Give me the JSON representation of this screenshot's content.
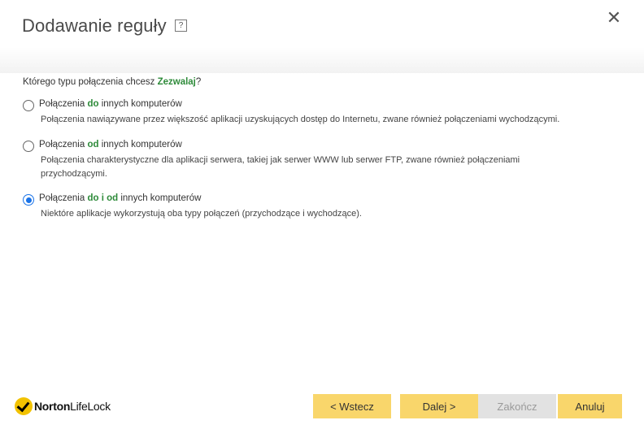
{
  "dialog": {
    "title": "Dodawanie reguły",
    "help_icon": "?",
    "close_icon": "✕"
  },
  "question": {
    "prefix": "Którego typu połączenia chcesz ",
    "accent": "Zezwalaj",
    "suffix": "?"
  },
  "options": [
    {
      "label_prefix": "Połączenia ",
      "label_accent": "do",
      "label_suffix": " innych komputerów",
      "description": "Połączenia nawiązywane przez większość aplikacji uzyskujących dostęp do Internetu, zwane również połączeniami wychodzącymi.",
      "selected": false
    },
    {
      "label_prefix": "Połączenia ",
      "label_accent": "od",
      "label_suffix": " innych komputerów",
      "description": "Połączenia charakterystyczne dla aplikacji serwera, takiej jak serwer WWW lub serwer FTP, zwane również połączeniami przychodzącymi.",
      "selected": false
    },
    {
      "label_prefix": "Połączenia ",
      "label_accent": "do i od",
      "label_suffix": " innych komputerów",
      "description": "Niektóre aplikacje wykorzystują oba typy połączeń (przychodzące i wychodzące).",
      "selected": true
    }
  ],
  "logo": {
    "part1": "Norton",
    "part2": "LifeLock"
  },
  "buttons": {
    "back": "< Wstecz",
    "next": "Dalej >",
    "finish": "Zakończ",
    "cancel": "Anuluj"
  },
  "colors": {
    "accent_green": "#2e8b3a",
    "button_yellow": "#f9d66b",
    "button_disabled": "#e2e2e2",
    "radio_selected": "#1a73e8"
  }
}
